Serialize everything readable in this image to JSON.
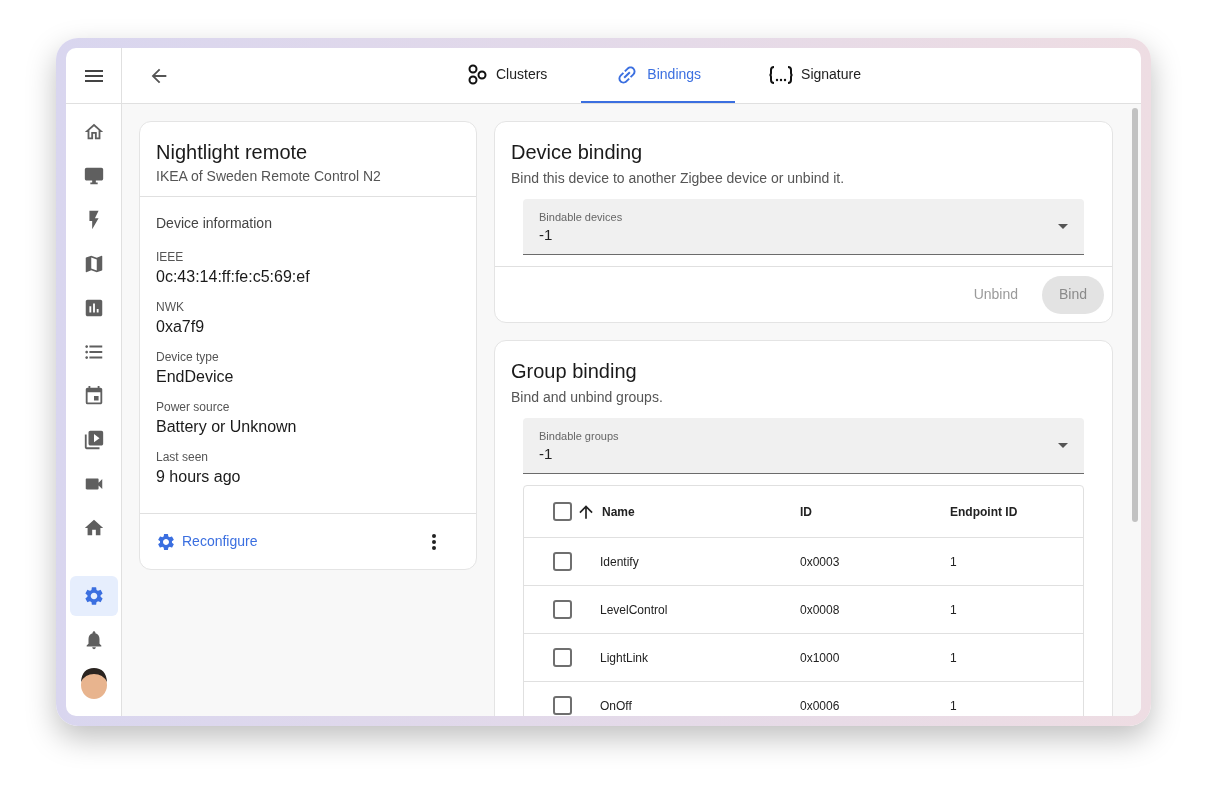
{
  "sidebar": {
    "items": [
      {
        "selected": false
      },
      {
        "selected": false
      },
      {
        "selected": false
      },
      {
        "selected": false
      },
      {
        "selected": false
      },
      {
        "selected": false
      },
      {
        "selected": false
      },
      {
        "selected": false
      },
      {
        "selected": false
      },
      {
        "selected": false
      }
    ],
    "footer_items": [
      {
        "selected": true
      },
      {
        "selected": false
      }
    ]
  },
  "tabs": [
    {
      "label": "Clusters",
      "selected": false
    },
    {
      "label": "Bindings",
      "selected": true
    },
    {
      "label": "Signature",
      "selected": false
    }
  ],
  "device": {
    "title": "Nightlight remote",
    "subtitle": "IKEA of Sweden Remote Control N2",
    "section": "Device information",
    "fields": [
      {
        "label": "IEEE",
        "value": "0c:43:14:ff:fe:c5:69:ef"
      },
      {
        "label": "NWK",
        "value": "0xa7f9"
      },
      {
        "label": "Device type",
        "value": "EndDevice"
      },
      {
        "label": "Power source",
        "value": "Battery or Unknown"
      },
      {
        "label": "Last seen",
        "value": "9 hours ago"
      }
    ],
    "action": "Reconfigure"
  },
  "device_binding": {
    "title": "Device binding",
    "description": "Bind this device to another Zigbee device or unbind it.",
    "select": {
      "label": "Bindable devices",
      "value": "-1"
    },
    "buttons": [
      {
        "label": "Unbind",
        "kind": "text",
        "disabled": true
      },
      {
        "label": "Bind",
        "kind": "filled",
        "disabled": true
      }
    ]
  },
  "group_binding": {
    "title": "Group binding",
    "description": "Bind and unbind groups.",
    "select": {
      "label": "Bindable groups",
      "value": "-1"
    },
    "table": {
      "header_checked": false,
      "columns": [
        "Name",
        "ID",
        "Endpoint ID"
      ],
      "rows": [
        {
          "checked": false,
          "cells": [
            "Identify",
            "0x0003",
            "1"
          ]
        },
        {
          "checked": false,
          "cells": [
            "LevelControl",
            "0x0008",
            "1"
          ]
        },
        {
          "checked": false,
          "cells": [
            "LightLink",
            "0x1000",
            "1"
          ]
        },
        {
          "checked": false,
          "cells": [
            "OnOff",
            "0x0006",
            "1"
          ]
        }
      ]
    }
  }
}
